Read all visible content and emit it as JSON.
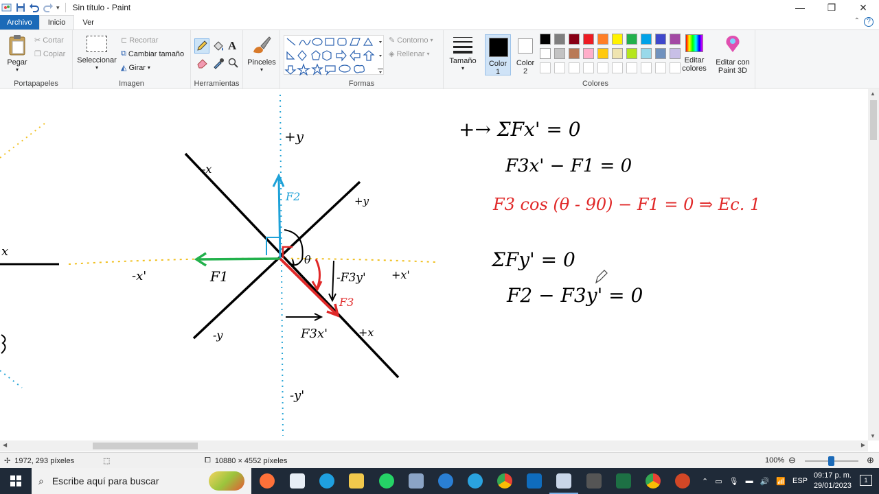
{
  "window": {
    "title": "Sin título - Paint",
    "minimize": "—",
    "maximize": "❐",
    "close": "✕"
  },
  "tabs": [
    {
      "label": "Archivo"
    },
    {
      "label": "Inicio"
    },
    {
      "label": "Ver"
    }
  ],
  "ribbon": {
    "clipboard": {
      "group": "Portapapeles",
      "paste": "Pegar",
      "cut": "Cortar",
      "copy": "Copiar"
    },
    "image": {
      "group": "Imagen",
      "select": "Seleccionar",
      "crop": "Recortar",
      "resize": "Cambiar tamaño",
      "rotate": "Girar"
    },
    "tools": {
      "group": "Herramientas"
    },
    "brushes": {
      "label": "Pinceles"
    },
    "shapes": {
      "group": "Formas",
      "outline": "Contorno",
      "fill": "Rellenar"
    },
    "size": {
      "label": "Tamaño"
    },
    "color1": {
      "line1": "Color",
      "line2": "1"
    },
    "color2": {
      "line1": "Color",
      "line2": "2"
    },
    "colors": {
      "group": "Colores",
      "edit_line1": "Editar",
      "edit_line2": "colores"
    },
    "paint3d": {
      "line1": "Editar con",
      "line2": "Paint 3D"
    },
    "palette_row1": [
      "#000000",
      "#7f7f7f",
      "#880015",
      "#ed1c24",
      "#ff7f27",
      "#fff200",
      "#22b14c",
      "#00a2e8",
      "#3f48cc",
      "#a349a4"
    ],
    "palette_row2": [
      "#ffffff",
      "#c3c3c3",
      "#b97a57",
      "#ffaec9",
      "#ffc90e",
      "#efe4b0",
      "#b5e61d",
      "#99d9ea",
      "#7092be",
      "#c8bfe7"
    ]
  },
  "canvas": {
    "labels": {
      "minus_x": "-x",
      "plus_y": "+y",
      "x_left": "x",
      "minus_x_prime": "-x'",
      "f1": "F1",
      "f2": "F2",
      "f3": "F3",
      "minus_f3y_prime": "-F3y'",
      "f3x_prime": "F3x'",
      "plus_x": "+x",
      "minus_y": "-y",
      "minus_y_prime": "-y'",
      "plus_y_prime": "+y'",
      "plus_x_prime": "+x'",
      "theta": "θ"
    },
    "equations": {
      "eq1": "+→ ΣFx' = 0",
      "eq2": "F3x' − F1 = 0",
      "eq3": "F3 cos (θ - 90) − F1 = 0  ⇒ Ec. 1",
      "eq4": "ΣFy' = 0",
      "eq5": "F2 − F3y' = 0"
    }
  },
  "status": {
    "cursor": "1972, 293 píxeles",
    "size": "10880 × 4552 píxeles",
    "zoom": "100%"
  },
  "taskbar": {
    "search_placeholder": "Escribe aquí para buscar",
    "lang": "ESP",
    "time": "09:17 p. m.",
    "date": "29/01/2023",
    "notifications": "1"
  }
}
